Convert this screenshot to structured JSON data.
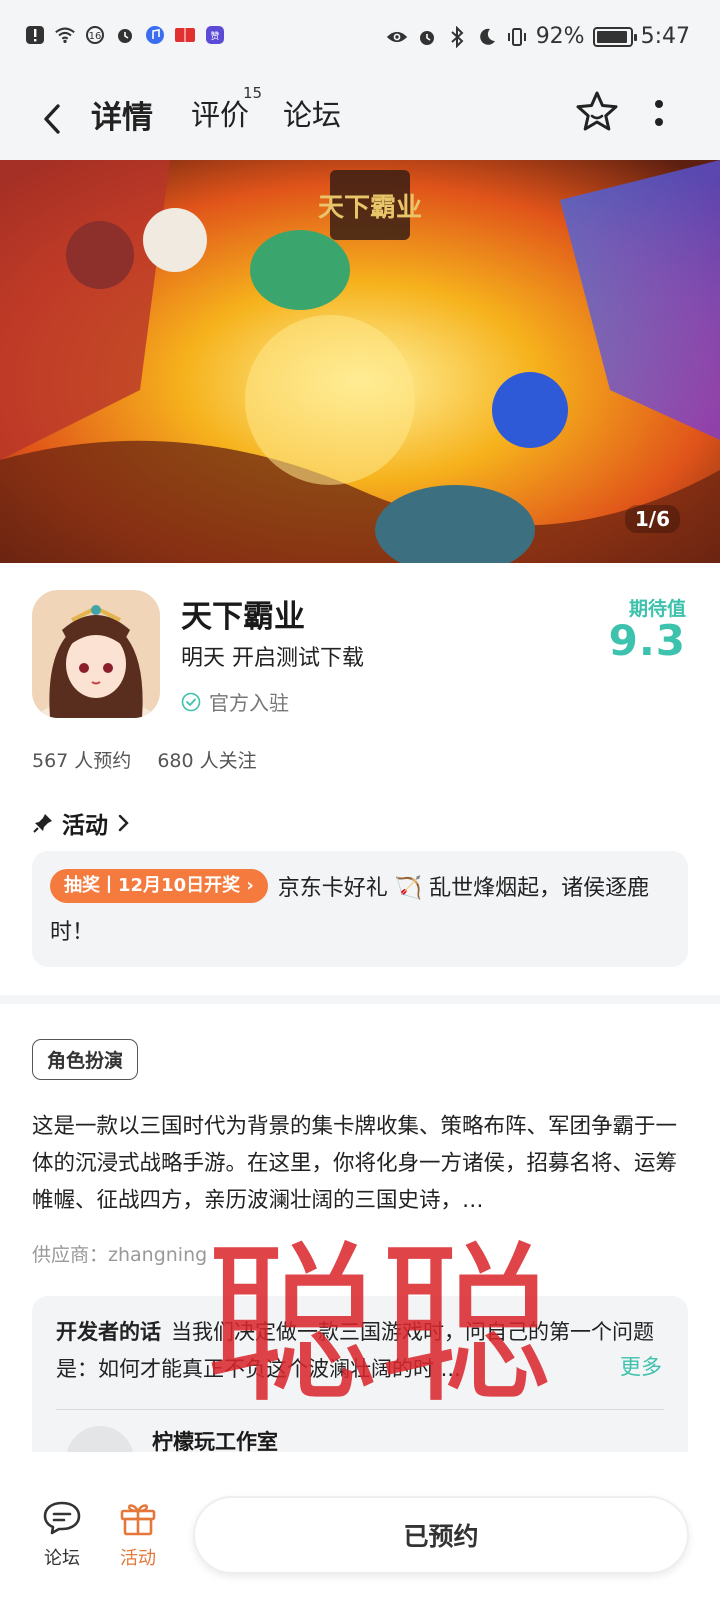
{
  "status_bar": {
    "battery": "92%",
    "time": "5:47"
  },
  "nav": {
    "tabs": [
      {
        "label": "详情",
        "active": true
      },
      {
        "label": "评价",
        "badge": "15"
      },
      {
        "label": "论坛"
      }
    ]
  },
  "banner": {
    "pager": "1/6",
    "logo_text": "天下霸业"
  },
  "app": {
    "name": "天下霸业",
    "subtitle": "明天 开启测试下载",
    "official": "官方入驻",
    "score_label": "期待值",
    "score": "9.3",
    "reservations": "567 人预约",
    "followers": "680 人关注"
  },
  "activity": {
    "title": "活动",
    "tag": "抽奖丨12月10日开奖",
    "text": "京东卡好礼 🏹 乱世烽烟起，诸侯逐鹿时！"
  },
  "genre": "角色扮演",
  "description": "这是一款以三国时代为背景的集卡牌收集、策略布阵、军团争霸于一体的沉浸式战略手游。在这里，你将化身一方诸侯，招募名将、运筹帷幄、征战四方，亲历波澜壮阔的三国史诗，…",
  "supplier": "供应商：zhangning",
  "developer": {
    "label": "开发者的话",
    "text": "当我们决定做一款三国游戏时，问自己的第一个问题是：如何才能真正不负这个波澜壮阔的时 ...",
    "more": "更多",
    "studio": "柠檬玩工作室"
  },
  "watermark": "聪聪",
  "bottom": {
    "forum": "论坛",
    "event": "活动",
    "reserved": "已预约"
  },
  "colors": {
    "accent": "#3cc2ad",
    "tag": "#f47a3d",
    "active_bottom": "#e6773a",
    "watermark": "#d9262b"
  }
}
